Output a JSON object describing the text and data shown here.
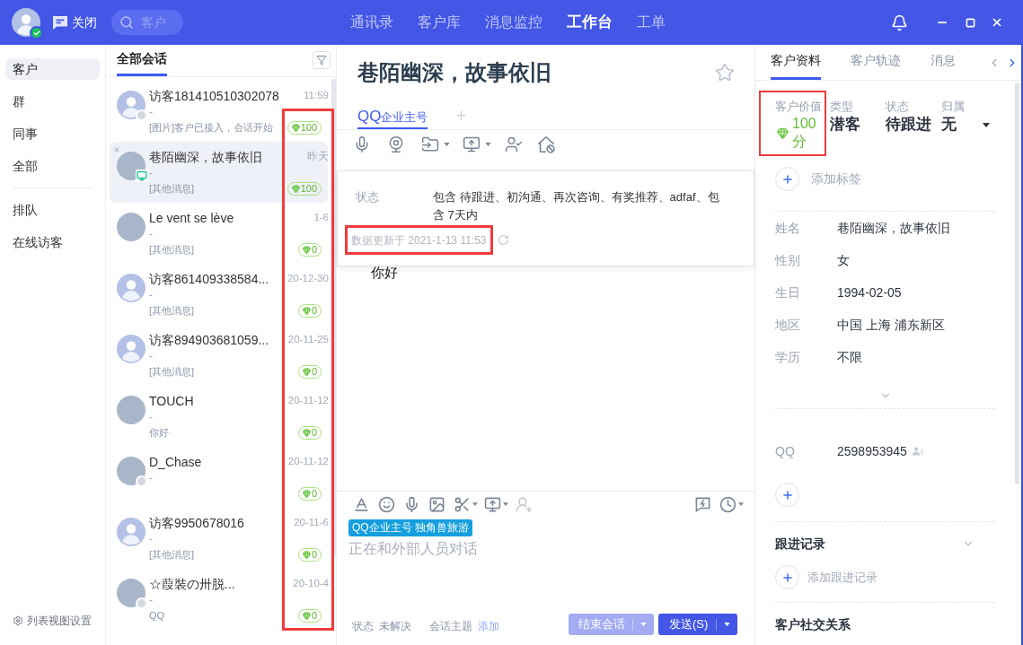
{
  "top_bar": {
    "user_online": true,
    "close_label": "关闭",
    "search": {
      "placeholder": "客户"
    },
    "nav": [
      {
        "label": "通讯录",
        "selected": false
      },
      {
        "label": "客户库",
        "selected": false
      },
      {
        "label": "消息监控",
        "selected": false
      },
      {
        "label": "工作台",
        "selected": true
      },
      {
        "label": "工单",
        "selected": false
      }
    ]
  },
  "sidebar": {
    "groups": [
      {
        "items": [
          {
            "label": "客户",
            "selected": true
          },
          {
            "label": "群",
            "selected": false
          },
          {
            "label": "同事",
            "selected": false
          },
          {
            "label": "全部",
            "selected": false
          }
        ]
      },
      {
        "items": [
          {
            "label": "排队",
            "selected": false
          },
          {
            "label": "在线访客",
            "selected": false
          }
        ]
      }
    ],
    "footer": "列表视图设置"
  },
  "conversation_list": {
    "tabs": [
      {
        "label": "全部会话",
        "selected": true
      }
    ],
    "values_highlighted": true,
    "rows": [
      {
        "name": "访客181410510302078",
        "time": "11:59",
        "subtitle": "-",
        "preview": "[图片]客户已接入，会话开始",
        "value": "100",
        "avatar": {
          "kind": "default"
        },
        "offline": true,
        "desktop": false,
        "selected": false
      },
      {
        "name": "巷陌幽深，故事依旧",
        "time": "昨天",
        "subtitle": "-",
        "preview": "[其他消息]",
        "value": "100",
        "avatar": {
          "kind": "photo"
        },
        "offline": false,
        "desktop": true,
        "selected": true
      },
      {
        "name": "Le vent se lève",
        "time": "1-6",
        "subtitle": "-",
        "preview": "[其他消息]",
        "value": "0",
        "avatar": {
          "kind": "photo"
        },
        "offline": false,
        "desktop": false,
        "selected": false
      },
      {
        "name": "访客861409338584...",
        "time": "20-12-30",
        "subtitle": "-",
        "preview": "[其他消息]",
        "value": "0",
        "avatar": {
          "kind": "default"
        },
        "offline": false,
        "desktop": false,
        "selected": false
      },
      {
        "name": "访客894903681059...",
        "time": "20-11-25",
        "subtitle": "-",
        "preview": "[其他消息]",
        "value": "0",
        "avatar": {
          "kind": "default"
        },
        "offline": false,
        "desktop": false,
        "selected": false
      },
      {
        "name": "TOUCH",
        "time": "20-11-12",
        "subtitle": "-",
        "preview": "你好",
        "value": "0",
        "avatar": {
          "kind": "photo"
        },
        "offline": false,
        "desktop": false,
        "selected": false
      },
      {
        "name": "D_Chase",
        "time": "20-11-12",
        "subtitle": "-",
        "value": "0",
        "avatar": {
          "kind": "photo"
        },
        "offline": true,
        "desktop": false,
        "selected": false
      },
      {
        "name": "访客9950678016",
        "time": "20-11-6",
        "subtitle": "-",
        "preview": "[其他消息]",
        "value": "0",
        "avatar": {
          "kind": "default"
        },
        "offline": false,
        "desktop": false,
        "selected": false
      },
      {
        "name": "☆葭裝の卅脱...",
        "time": "20-10-4",
        "subtitle": "-",
        "preview": "QQ",
        "value": "0",
        "avatar": {
          "kind": "photo"
        },
        "offline": true,
        "desktop": false,
        "selected": false
      }
    ]
  },
  "chat": {
    "title": "巷陌幽深，故事依旧",
    "starred": false,
    "channels": [
      {
        "label": "QQ",
        "sublabel": "企业主号",
        "selected": true
      }
    ],
    "messages": [
      {
        "text": "你好"
      }
    ]
  },
  "filter_popup": {
    "rows": [
      {
        "label": "状态",
        "value": "包含 待跟进、初沟通、再次咨询、有奖推荐、adfaf、包含 7天内"
      }
    ],
    "update_note": {
      "text": "数据更新于 2021-1-13 11:53",
      "highlighted": true
    }
  },
  "composer": {
    "account_tag": "QQ企业主号 独角兽旅游",
    "placeholder": "正在和外部人员对话",
    "status": {
      "label": "状态",
      "value": "未解决"
    },
    "topic": {
      "label": "会话主题",
      "action": "添加"
    },
    "end_button": {
      "label": "结束会话",
      "disabled": true
    },
    "send_button": {
      "label": "发送(S)"
    }
  },
  "customer_panel": {
    "tabs": [
      {
        "label": "客户资料",
        "selected": true
      },
      {
        "label": "客户轨迹",
        "selected": false
      },
      {
        "label": "消息",
        "selected": false
      }
    ],
    "summary": [
      {
        "kind": "value",
        "label": "客户价值",
        "value": "100 分",
        "highlighted": true
      },
      {
        "kind": "text",
        "label": "类型",
        "value": "潜客",
        "highlighted": false
      },
      {
        "kind": "text",
        "label": "状态",
        "value": "待跟进",
        "highlighted": false
      },
      {
        "kind": "select",
        "label": "归属",
        "value": "无",
        "highlighted": false
      }
    ],
    "add_tag": "添加标签",
    "fields": [
      {
        "label": "姓名",
        "value": "巷陌幽深，故事依旧"
      },
      {
        "label": "性别",
        "value": "女"
      },
      {
        "label": "生日",
        "value": "1994-02-05"
      },
      {
        "label": "地区",
        "value": "中国 上海 浦东新区"
      },
      {
        "label": "学历",
        "value": "不限"
      }
    ],
    "contacts": [
      {
        "label": "QQ",
        "value": "2598953945"
      }
    ],
    "sections": [
      {
        "title": "跟进记录",
        "action": "添加跟进记录"
      },
      {
        "title": "客户社交关系"
      }
    ]
  }
}
